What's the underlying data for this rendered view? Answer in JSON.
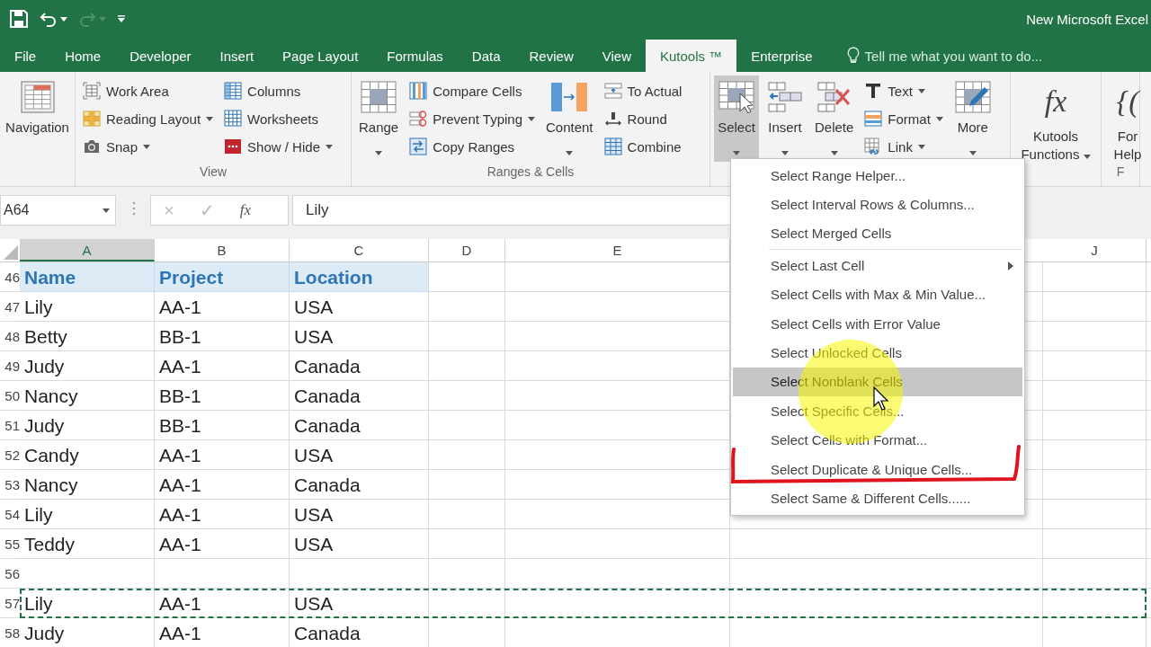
{
  "title_bar": {
    "title": "New Microsoft Excel"
  },
  "ribbon_tabs": [
    {
      "label": "File",
      "selected": false
    },
    {
      "label": "Home",
      "selected": false
    },
    {
      "label": "Developer",
      "selected": false
    },
    {
      "label": "Insert",
      "selected": false
    },
    {
      "label": "Page Layout",
      "selected": false
    },
    {
      "label": "Formulas",
      "selected": false
    },
    {
      "label": "Data",
      "selected": false
    },
    {
      "label": "Review",
      "selected": false
    },
    {
      "label": "View",
      "selected": false
    },
    {
      "label": "Kutools ™",
      "selected": true
    },
    {
      "label": "Enterprise",
      "selected": false
    }
  ],
  "tell_me": "Tell me what you want to do...",
  "ribbon_groups": [
    {
      "controls": [
        {
          "kind": "large",
          "label": "Navigation",
          "menu": false,
          "pressed": false
        }
      ]
    },
    {
      "label": "View",
      "controls": [
        {
          "kind": "stack",
          "buttons": [
            {
              "label": "Work Area",
              "menu": false
            },
            {
              "label": "Reading Layout",
              "menu": true
            },
            {
              "label": "Snap",
              "menu": true
            }
          ]
        },
        {
          "kind": "stack",
          "buttons": [
            {
              "label": "Columns",
              "menu": false
            },
            {
              "label": "Worksheets",
              "menu": false
            },
            {
              "label": "Show / Hide",
              "menu": true
            }
          ]
        }
      ]
    },
    {
      "label": "Ranges & Cells",
      "controls": [
        {
          "kind": "large",
          "label": "Range",
          "menu": true,
          "pressed": false
        },
        {
          "kind": "stack",
          "buttons": [
            {
              "label": "Compare Cells",
              "menu": false
            },
            {
              "label": "Prevent Typing",
              "menu": true
            },
            {
              "label": "Copy Ranges",
              "menu": false
            }
          ]
        },
        {
          "kind": "large",
          "label": "Content",
          "menu": true,
          "pressed": false
        },
        {
          "kind": "stack",
          "buttons": [
            {
              "label": "To Actual",
              "menu": false
            },
            {
              "label": "Round",
              "menu": false
            },
            {
              "label": "Combine",
              "menu": false
            }
          ]
        }
      ]
    },
    {
      "controls": [
        {
          "kind": "large",
          "label": "Select",
          "menu": true,
          "pressed": true
        },
        {
          "kind": "large",
          "label": "Insert",
          "menu": true,
          "pressed": false
        },
        {
          "kind": "large",
          "label": "Delete",
          "menu": true,
          "pressed": false
        },
        {
          "kind": "stack",
          "buttons": [
            {
              "label": "Text",
              "menu": true
            },
            {
              "label": "Format",
              "menu": true
            },
            {
              "label": "Link",
              "menu": true
            }
          ]
        },
        {
          "kind": "large",
          "label": "More",
          "menu": true,
          "pressed": false
        }
      ]
    },
    {
      "controls": [
        {
          "kind": "large",
          "label": "Kutools Functions",
          "menu": true,
          "pressed": false,
          "icon_text": "fx"
        }
      ]
    },
    {
      "label": "F",
      "controls": [
        {
          "kind": "large",
          "label": "For Help",
          "pressed": false,
          "icon_text": "{("
        }
      ]
    }
  ],
  "formula_bar": {
    "name_box": "A64",
    "cancel": "×",
    "enter": "✓",
    "function": "fx",
    "value": "Lily"
  },
  "sheet": {
    "columns": [
      {
        "label": "A",
        "selected": true
      },
      {
        "label": "B",
        "selected": false
      },
      {
        "label": "C",
        "selected": false
      },
      {
        "label": "D",
        "selected": false
      },
      {
        "label": "E",
        "selected": false
      },
      {
        "label": "J",
        "selected": false
      }
    ],
    "rows": [
      {
        "number": "46",
        "kind": "header",
        "copy_marked": false,
        "cells": [
          "Name",
          "Project",
          "Location"
        ]
      },
      {
        "number": "47",
        "kind": "data",
        "copy_marked": false,
        "cells": [
          "Lily",
          "AA-1",
          "USA"
        ]
      },
      {
        "number": "48",
        "kind": "data",
        "copy_marked": false,
        "cells": [
          "Betty",
          "BB-1",
          "USA"
        ]
      },
      {
        "number": "49",
        "kind": "data",
        "copy_marked": false,
        "cells": [
          "Judy",
          "AA-1",
          "Canada"
        ]
      },
      {
        "number": "50",
        "kind": "data",
        "copy_marked": false,
        "cells": [
          "Nancy",
          "BB-1",
          "Canada"
        ]
      },
      {
        "number": "51",
        "kind": "data",
        "copy_marked": false,
        "cells": [
          "Judy",
          "BB-1",
          "Canada"
        ]
      },
      {
        "number": "52",
        "kind": "data",
        "copy_marked": false,
        "cells": [
          "Candy",
          "AA-1",
          "USA"
        ]
      },
      {
        "number": "53",
        "kind": "data",
        "copy_marked": false,
        "cells": [
          "Nancy",
          "AA-1",
          "Canada"
        ]
      },
      {
        "number": "54",
        "kind": "data",
        "copy_marked": false,
        "cells": [
          "Lily",
          "AA-1",
          "USA"
        ]
      },
      {
        "number": "55",
        "kind": "data",
        "copy_marked": false,
        "cells": [
          "Teddy",
          "AA-1",
          "USA"
        ]
      },
      {
        "number": "56",
        "kind": "data",
        "copy_marked": false
      },
      {
        "number": "57",
        "kind": "data",
        "copy_marked": true,
        "cells": [
          "Lily",
          "AA-1",
          "USA"
        ]
      },
      {
        "number": "58",
        "kind": "data",
        "copy_marked": false,
        "cells": [
          "Judy",
          "AA-1",
          "Canada"
        ]
      }
    ]
  },
  "select_menu": [
    {
      "kind": "item",
      "label": "Select Range Helper...",
      "selected": false,
      "submenu": false
    },
    {
      "kind": "item",
      "label": "Select Interval Rows & Columns...",
      "selected": false,
      "submenu": false
    },
    {
      "kind": "item",
      "label": "Select Merged Cells",
      "selected": false,
      "submenu": false
    },
    {
      "kind": "separator"
    },
    {
      "kind": "item",
      "label": "Select Last Cell",
      "selected": false,
      "submenu": true
    },
    {
      "kind": "item",
      "label": "Select Cells with Max & Min Value...",
      "selected": false,
      "submenu": false
    },
    {
      "kind": "item",
      "label": "Select Cells with Error Value",
      "selected": false,
      "submenu": false
    },
    {
      "kind": "item",
      "label": "Select Unlocked Cells",
      "selected": false,
      "submenu": false
    },
    {
      "kind": "item",
      "label": "Select Nonblank Cells",
      "selected": true,
      "submenu": false
    },
    {
      "kind": "item",
      "label": "Select Specific Cells...",
      "selected": false,
      "submenu": false
    },
    {
      "kind": "item",
      "label": "Select Cells with Format...",
      "selected": false,
      "submenu": false
    },
    {
      "kind": "item",
      "label": "Select Duplicate & Unique Cells...",
      "selected": false,
      "submenu": false
    },
    {
      "kind": "item",
      "label": "Select Same & Different Cells......",
      "selected": false,
      "submenu": false
    }
  ]
}
